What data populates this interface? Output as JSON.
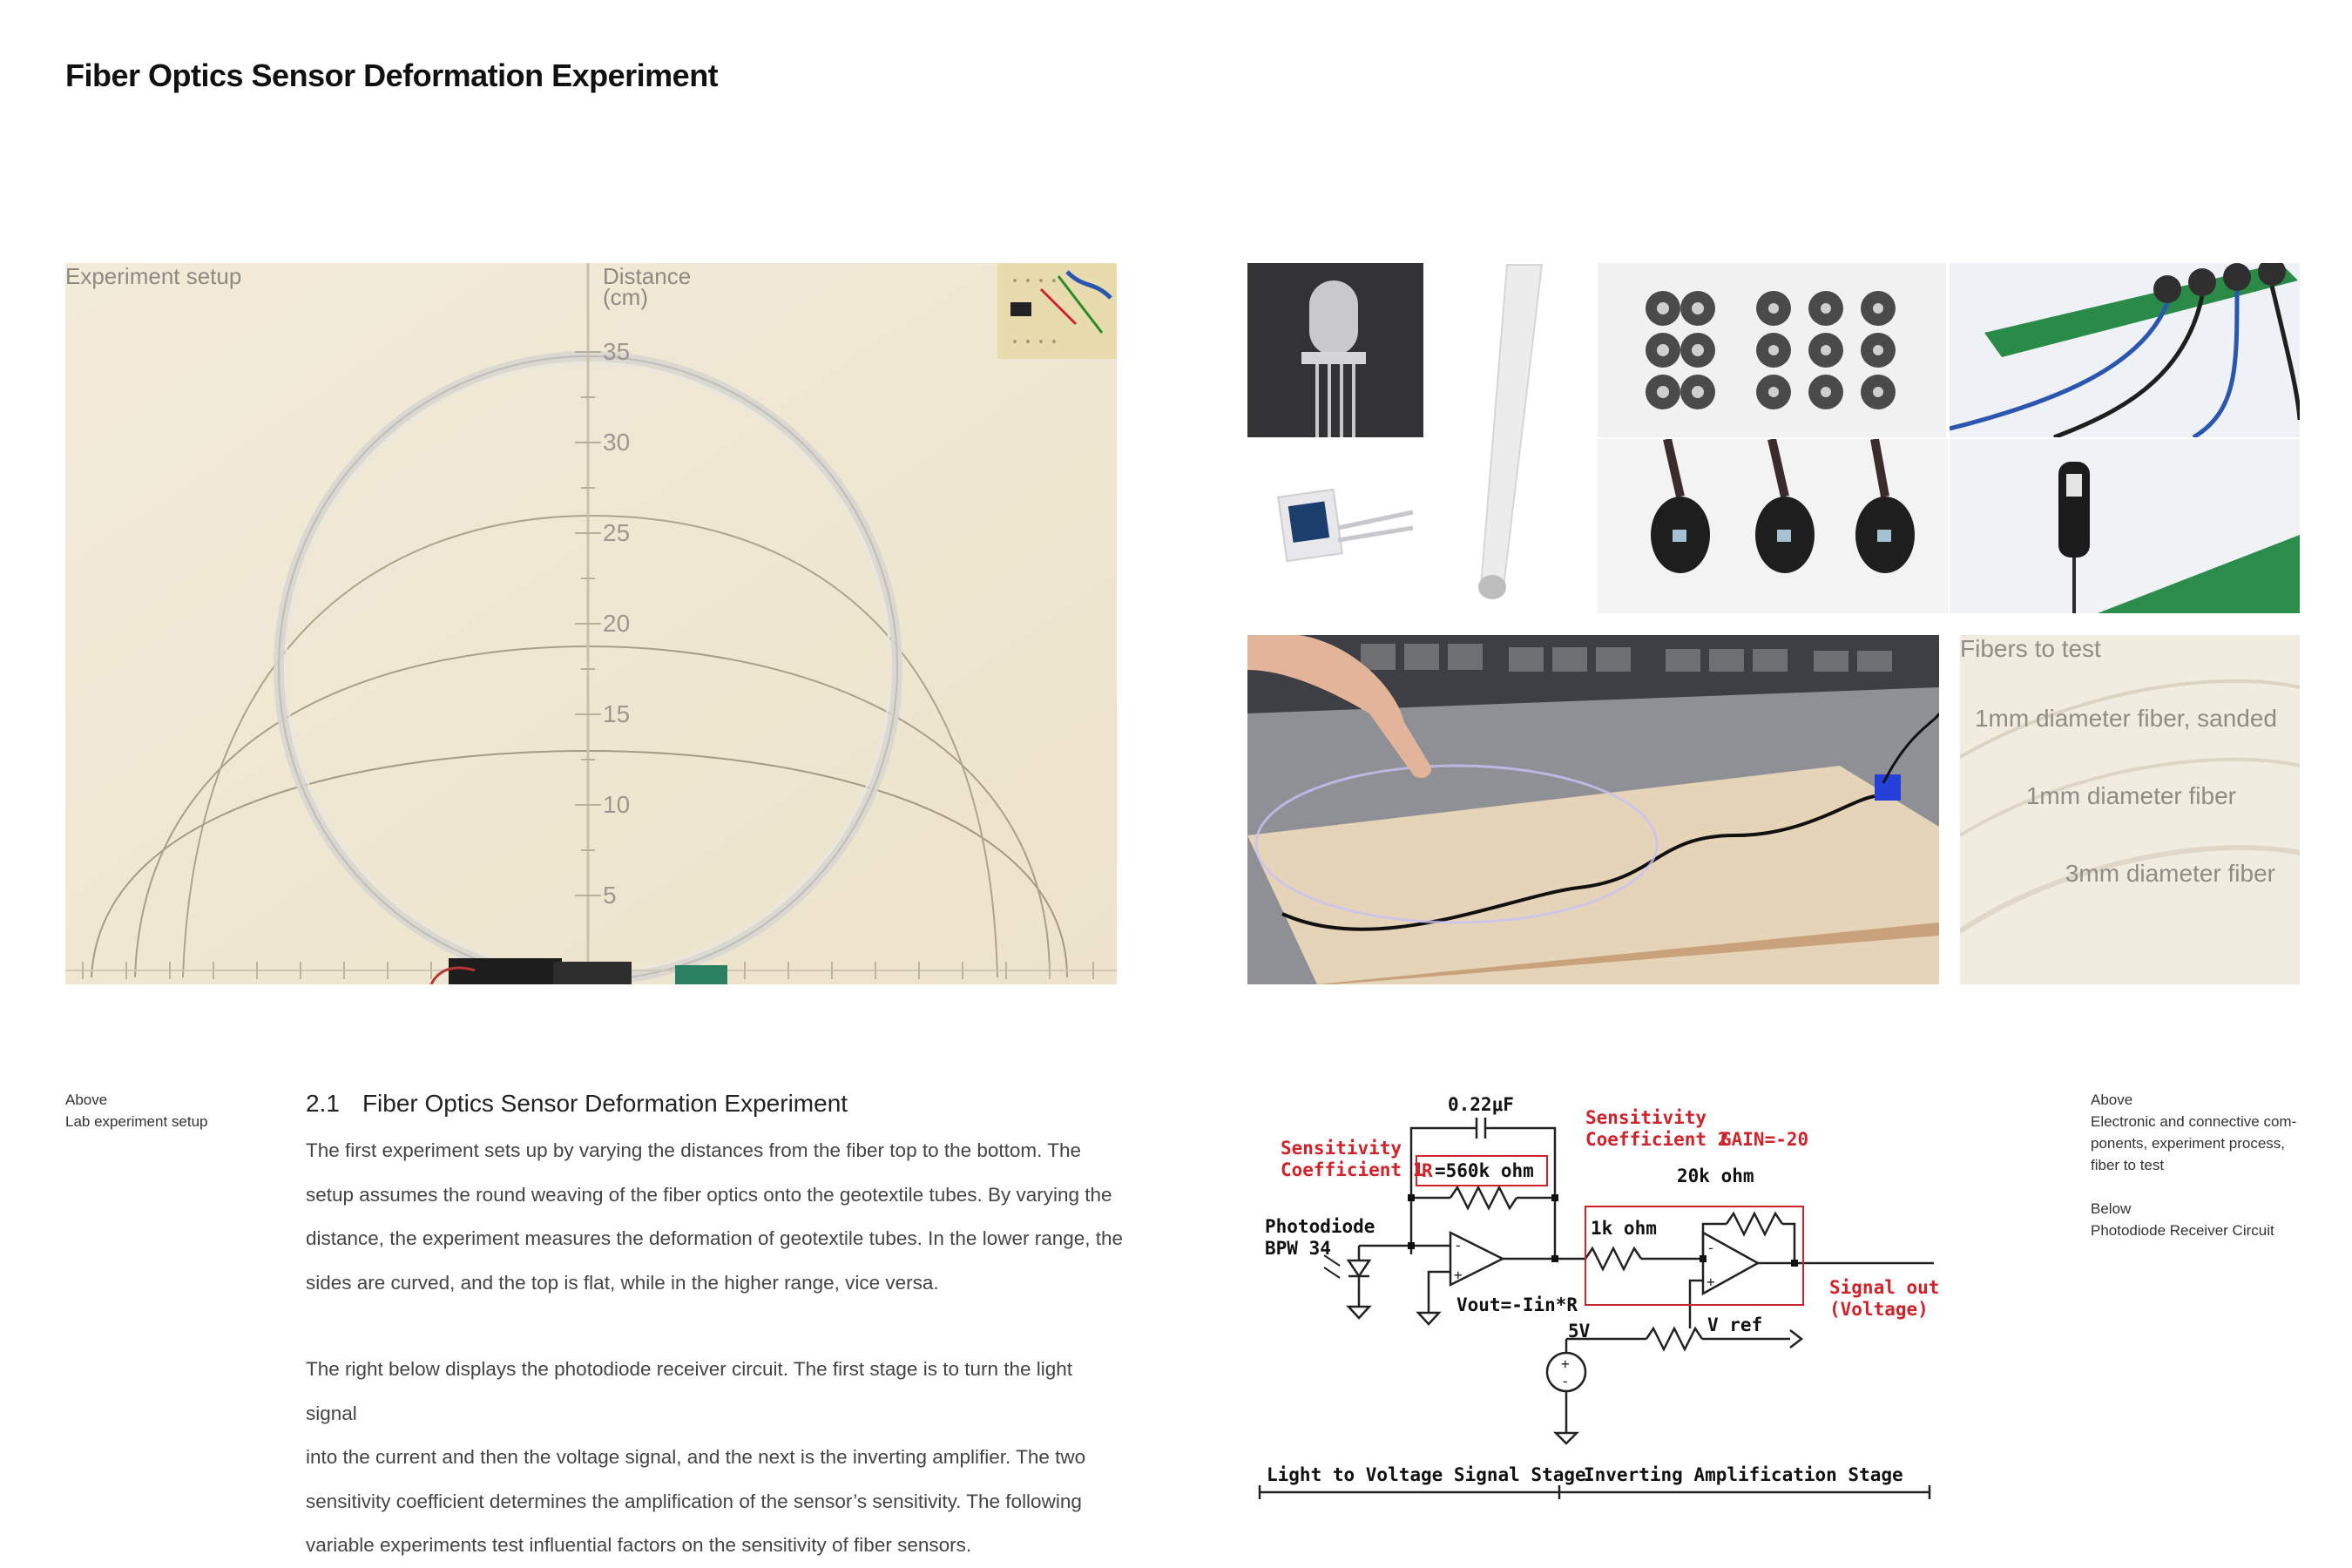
{
  "page": {
    "title": "Fiber Optics Sensor Deformation Experiment"
  },
  "experiment_photo": {
    "setup_label": "Experiment setup",
    "distance_label_line1": "Distance",
    "distance_label_line2": "(cm)",
    "ruler_marks": [
      "35",
      "30",
      "25",
      "20",
      "15",
      "10",
      "5"
    ]
  },
  "fibers_panel": {
    "title": "Fibers to test",
    "items": [
      "1mm diameter fiber, sanded",
      "1mm diameter fiber",
      "3mm diameter fiber"
    ]
  },
  "left_caption": {
    "line1": "Above",
    "line2": "Lab experiment setup"
  },
  "right_caption": {
    "above_label": "Above",
    "above_lines": [
      "Electronic and connective com-",
      "ponents, experiment process,",
      "fiber to test"
    ],
    "below_label": "Below",
    "below_line": "Photodiode Receiver Circuit"
  },
  "section": {
    "number": "2.1",
    "heading": "Fiber Optics Sensor Deformation Experiment",
    "paragraph1": [
      "The first experiment sets up by varying the distances from the fiber top to the bottom. The",
      "setup assumes the round weaving of the fiber optics onto the geotextile tubes. By varying the",
      "distance, the experiment measures the deformation of geotextile tubes. In the lower range, the",
      "sides are curved, and the top is flat, while in the higher range, vice versa."
    ],
    "paragraph2": [
      "The right below displays the photodiode receiver circuit. The first stage is to turn the light signal",
      "into the current and then the voltage signal, and the next is the inverting amplifier. The two",
      "sensitivity coefficient determines the amplification of the sensor’s sensitivity. The following",
      "variable experiments test influential factors on the sensitivity of fiber sensors."
    ]
  },
  "circuit": {
    "capacitor": "0.22μF",
    "sens1_line1": "Sensitivity",
    "sens1_line2": "Coefficient 1",
    "r1_prefix": "R",
    "r1_value": "=560k ohm",
    "sens2_line1": "Sensitivity",
    "sens2_line2": "Coefficient 2",
    "gain": "GAIN=-20",
    "r3": "20k ohm",
    "photodiode_line1": "Photodiode",
    "photodiode_line2": "BPW 34",
    "r2": "1k ohm",
    "vout": "Vout=-Iin*R",
    "supply": "5V",
    "vref": "V ref",
    "signal_out_line1": "Signal out",
    "signal_out_line2": "(Voltage)",
    "stage1": "Light to Voltage Signal Stage",
    "stage2": "Inverting Amplification Stage",
    "colors": {
      "red": "#d0222a",
      "black": "#111111"
    }
  }
}
